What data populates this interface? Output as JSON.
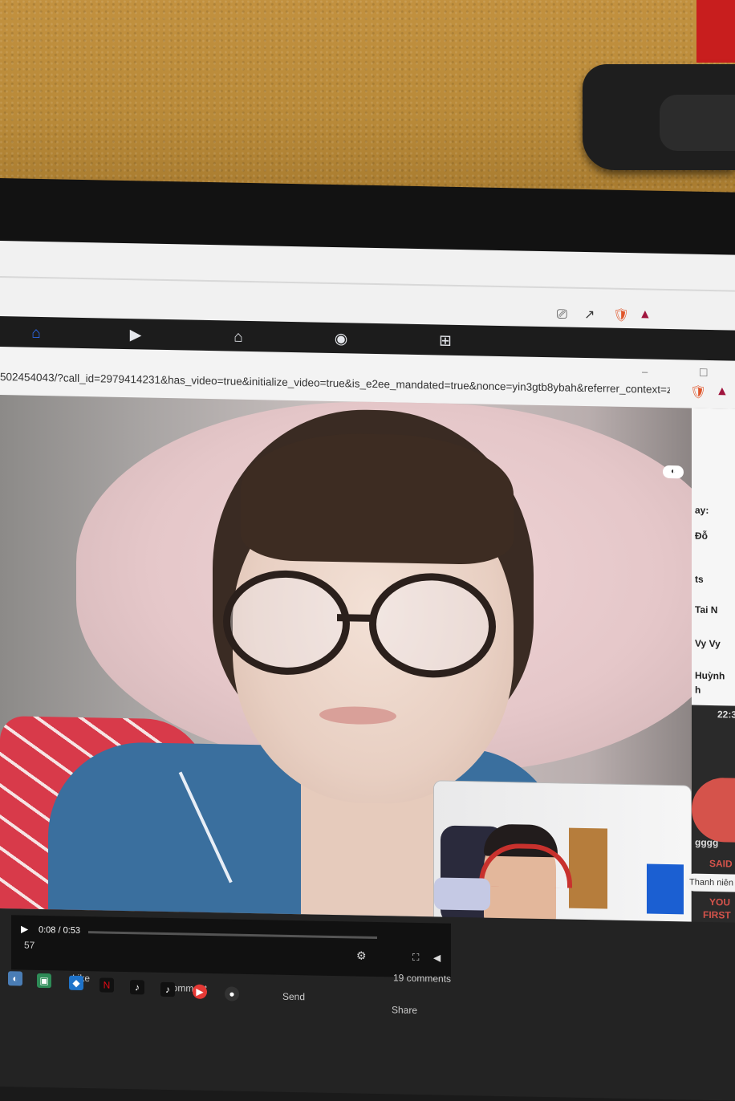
{
  "browser": {
    "url": "502454043/?call_id=2979414231&has_video=true&initialize_video=true&is_e2ee_mandated=true&nonce=yin3gtb8ybah&referrer_context=zen...",
    "window_controls": "– ☐"
  },
  "nav": {
    "home_icon": "home-icon",
    "video_icon": "video-icon",
    "marketplace_icon": "marketplace-icon",
    "groups_icon": "groups-icon",
    "gaming_icon": "gaming-icon"
  },
  "call": {
    "more_label": "•••",
    "game_label": "◐"
  },
  "chat": {
    "names": [
      "ay:",
      "Đỗ",
      "ts",
      "Tai N",
      "Vy Vy",
      "Huỳnh",
      "h",
      "22:3"
    ],
    "bubble": "Thanh niên",
    "gggg": "gggg",
    "handwriting": [
      "SAID",
      "YOU",
      "FIRST"
    ]
  },
  "video_player": {
    "time": "0:08 / 0:53",
    "reaction_count": "57",
    "like_label": "Like",
    "comment_label": "Comment",
    "send_label": "Send",
    "share_label": "Share",
    "comments_count": "19 comments"
  }
}
